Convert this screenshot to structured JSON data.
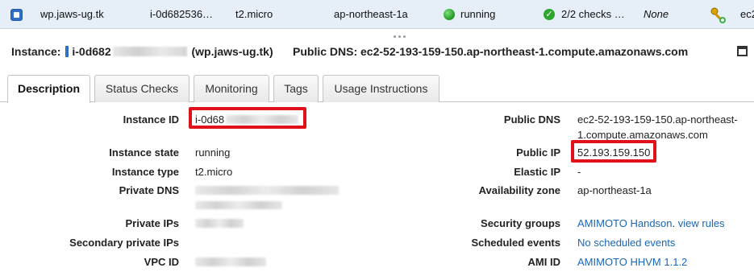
{
  "instance_row": {
    "name": "wp.jaws-ug.tk",
    "instance_id": "i-0d682536…",
    "instance_type": "t2.micro",
    "availability_zone": "ap-northeast-1a",
    "state": "running",
    "status_checks": "2/2 checks …",
    "alarm_status": "None",
    "public_dns_truncated": "ec2"
  },
  "header": {
    "instance_label": "Instance:",
    "instance_id_prefix": "i-0d682",
    "instance_name": "(wp.jaws-ug.tk)",
    "public_dns_label": "Public DNS:",
    "public_dns": "ec2-52-193-159-150.ap-northeast-1.compute.amazonaws.com"
  },
  "tabs": [
    {
      "label": "Description",
      "active": true
    },
    {
      "label": "Status Checks",
      "active": false
    },
    {
      "label": "Monitoring",
      "active": false
    },
    {
      "label": "Tags",
      "active": false
    },
    {
      "label": "Usage Instructions",
      "active": false
    }
  ],
  "details_left": {
    "instance_id_label": "Instance ID",
    "instance_id_value": "i-0d68",
    "instance_state_label": "Instance state",
    "instance_state_value": "running",
    "instance_type_label": "Instance type",
    "instance_type_value": "t2.micro",
    "private_dns_label": "Private DNS",
    "private_ips_label": "Private IPs",
    "secondary_private_ips_label": "Secondary private IPs",
    "vpc_id_label": "VPC ID"
  },
  "details_right": {
    "public_dns_label": "Public DNS",
    "public_dns_line1": "ec2-52-193-159-150.ap-northeast-",
    "public_dns_line2": "1.compute.amazonaws.com",
    "public_ip_label": "Public IP",
    "public_ip_value": "52.193.159.150",
    "elastic_ip_label": "Elastic IP",
    "elastic_ip_value": "-",
    "availability_zone_label": "Availability zone",
    "availability_zone_value": "ap-northeast-1a",
    "security_groups_label": "Security groups",
    "security_group_value": "AMIMOTO Handson",
    "view_rules_link": "view rules",
    "scheduled_events_label": "Scheduled events",
    "scheduled_events_value": "No scheduled events",
    "ami_id_label": "AMI ID",
    "ami_id_value": "AMIMOTO HHVM 1.1.2"
  },
  "colors": {
    "selected_row": "#e6eef8",
    "link": "#1a66b8",
    "highlight_border": "#e0111b",
    "running_green": "#2ca02c"
  }
}
